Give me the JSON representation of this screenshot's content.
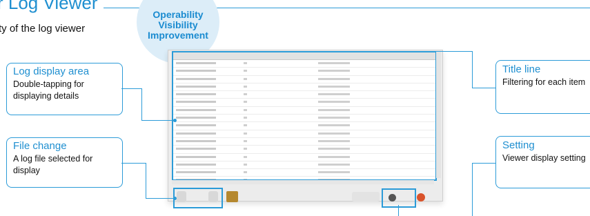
{
  "header": {
    "title_partial": "r Log Viewer",
    "intro_text": "ty of the log viewer"
  },
  "badge": {
    "lines": [
      "Operability",
      "Visibility",
      "Improvement"
    ]
  },
  "callouts": {
    "log_display": {
      "title": "Log display area",
      "desc": "Double-tapping for displaying details"
    },
    "file_change": {
      "title": "File change",
      "desc": "A log file selected for display"
    },
    "title_line": {
      "title": "Title line",
      "desc": "Filtering for each item"
    },
    "setting": {
      "title": "Setting",
      "desc": "Viewer display setting"
    }
  },
  "colors": {
    "accent": "#2b9bd8",
    "accent_text": "#1f8fd0",
    "badge_bg": "#dcedf8"
  },
  "icons": [
    "gear-icon",
    "close-icon",
    "image-icon"
  ]
}
